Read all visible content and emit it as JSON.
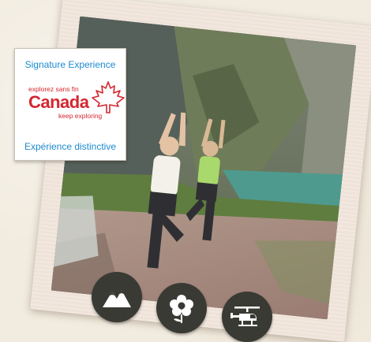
{
  "badge": {
    "top_label": "Signature Experience",
    "tagline_fr": "explorez sans fin",
    "wordmark": "Canada",
    "tagline_en": "keep exploring",
    "bottom_label": "Expérience distinctive",
    "colors": {
      "label_blue": "#1c8ad1",
      "brand_red": "#d5262f"
    },
    "icon": "maple-leaf-icon"
  },
  "photo": {
    "subject": "yoga-tree-pose-by-mountain-lake"
  },
  "activities": [
    {
      "name": "mountains-icon"
    },
    {
      "name": "flower-icon"
    },
    {
      "name": "helicopter-icon"
    }
  ],
  "colors": {
    "background": "#f2ece0",
    "frame": "#efe3d9",
    "icon_circle": "#3a3a34"
  }
}
